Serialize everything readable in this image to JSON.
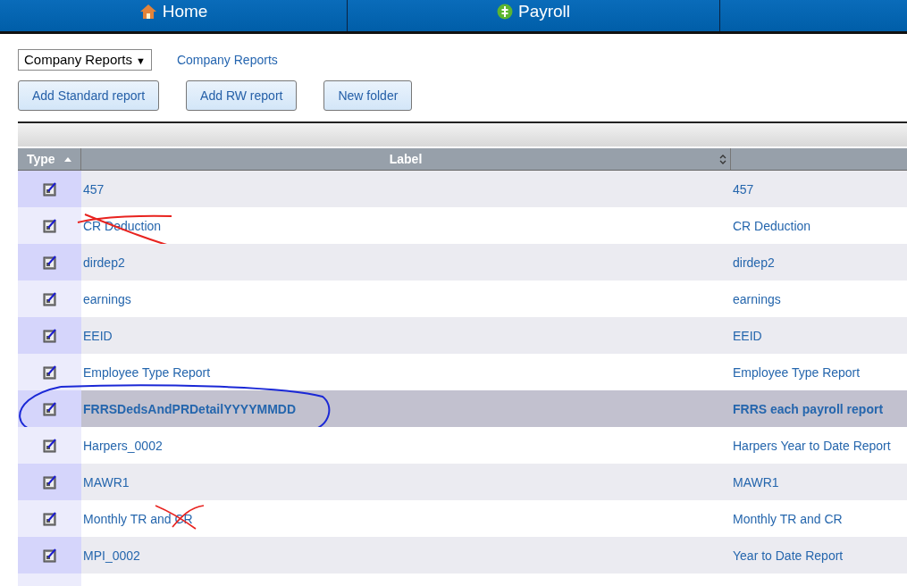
{
  "nav": [
    {
      "label": "Home",
      "kind": "home"
    },
    {
      "label": "Payroll",
      "kind": "payroll"
    }
  ],
  "folder_select": {
    "value": "Company Reports",
    "caret": "▼"
  },
  "breadcrumb": "Company Reports",
  "buttons": [
    "Add Standard report",
    "Add RW report",
    "New folder"
  ],
  "table": {
    "columns": [
      {
        "label": "Type",
        "kind": "sorted_ascending"
      },
      {
        "label": "Label",
        "kind": "sortable"
      }
    ],
    "rows": [
      {
        "label": "457",
        "column_3": "457",
        "selected": false
      },
      {
        "label": "CR Deduction",
        "column_3": "CR Deduction",
        "selected": false,
        "annotation": {
          "kind": "strike"
        }
      },
      {
        "label": "dirdep2",
        "column_3": "dirdep2",
        "selected": false
      },
      {
        "label": "earnings",
        "column_3": "earnings",
        "selected": false
      },
      {
        "label": "EEID",
        "column_3": "EEID",
        "selected": false
      },
      {
        "label": "Employee Type Report",
        "column_3": "Employee Type Report",
        "selected": false
      },
      {
        "label": "FRRSDedsAndPRDetailYYYYMMDD",
        "column_3": "FRRS each payroll report",
        "selected": true,
        "annotation": {
          "kind": "circle"
        }
      },
      {
        "label": "Harpers_0002",
        "column_3": "Harpers Year to Date Report",
        "selected": false
      },
      {
        "label": "MAWR1",
        "column_3": "MAWR1",
        "selected": false
      },
      {
        "label": "Monthly TR and CR",
        "column_3": "Monthly TR and CR",
        "selected": false,
        "annotation": {
          "kind": "cross"
        }
      },
      {
        "label": "MPI_0002",
        "column_3": "Year to Date Report",
        "selected": false
      }
    ]
  }
}
